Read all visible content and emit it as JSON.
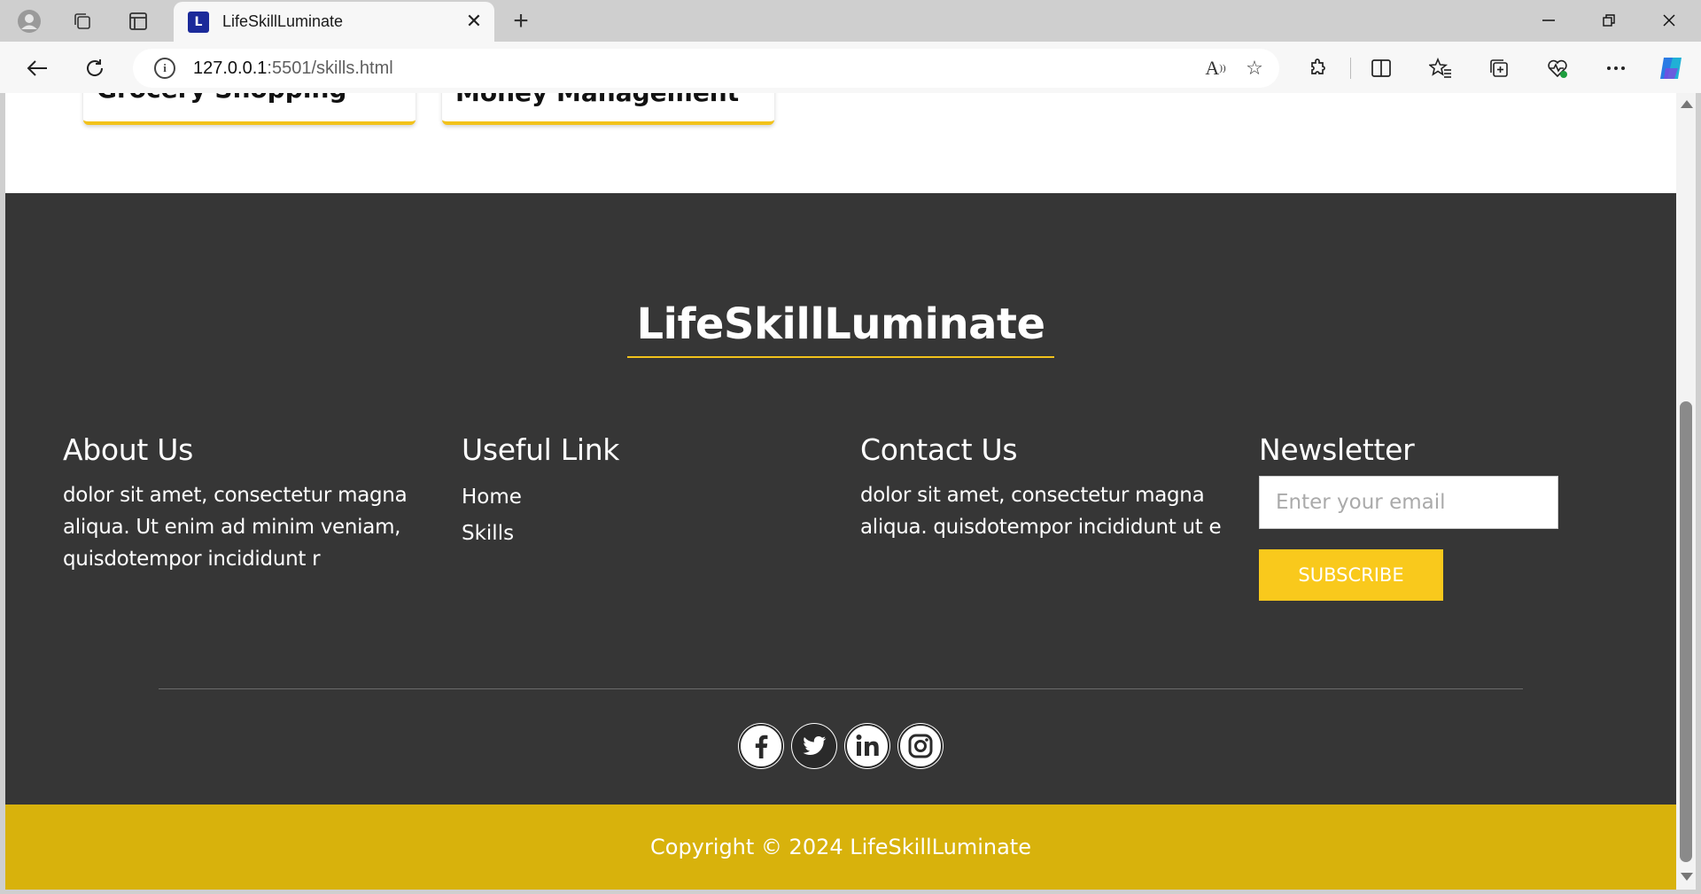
{
  "browser": {
    "tab_title": "LifeSkillLuminate",
    "tab_favicon": "L",
    "url_host": "127.0.0.1",
    "url_rest": ":5501/skills.html"
  },
  "page": {
    "cards": [
      {
        "title": "Grocery Shopping"
      },
      {
        "title": "Money Management"
      }
    ],
    "footer": {
      "brand": "LifeSkillLuminate",
      "about": {
        "heading": "About Us",
        "text": "dolor sit amet, consectetur magna aliqua. Ut enim ad minim veniam, quisdotempor incididunt r"
      },
      "useful": {
        "heading": "Useful Link",
        "links": [
          "Home",
          "Skills"
        ]
      },
      "contact": {
        "heading": "Contact Us",
        "text": "dolor sit amet, consectetur magna aliqua. quisdotempor incididunt ut e"
      },
      "newsletter": {
        "heading": "Newsletter",
        "placeholder": "Enter your email",
        "button": "SUBSCRIBE"
      },
      "socials": [
        "facebook-icon",
        "twitter-icon",
        "linkedin-icon",
        "instagram-icon"
      ],
      "copyright": "Copyright © 2024 LifeSkillLuminate"
    }
  },
  "colors": {
    "footer_bg": "#363636",
    "accent": "#f9c91c",
    "copyright_bg": "#d8b20c"
  }
}
